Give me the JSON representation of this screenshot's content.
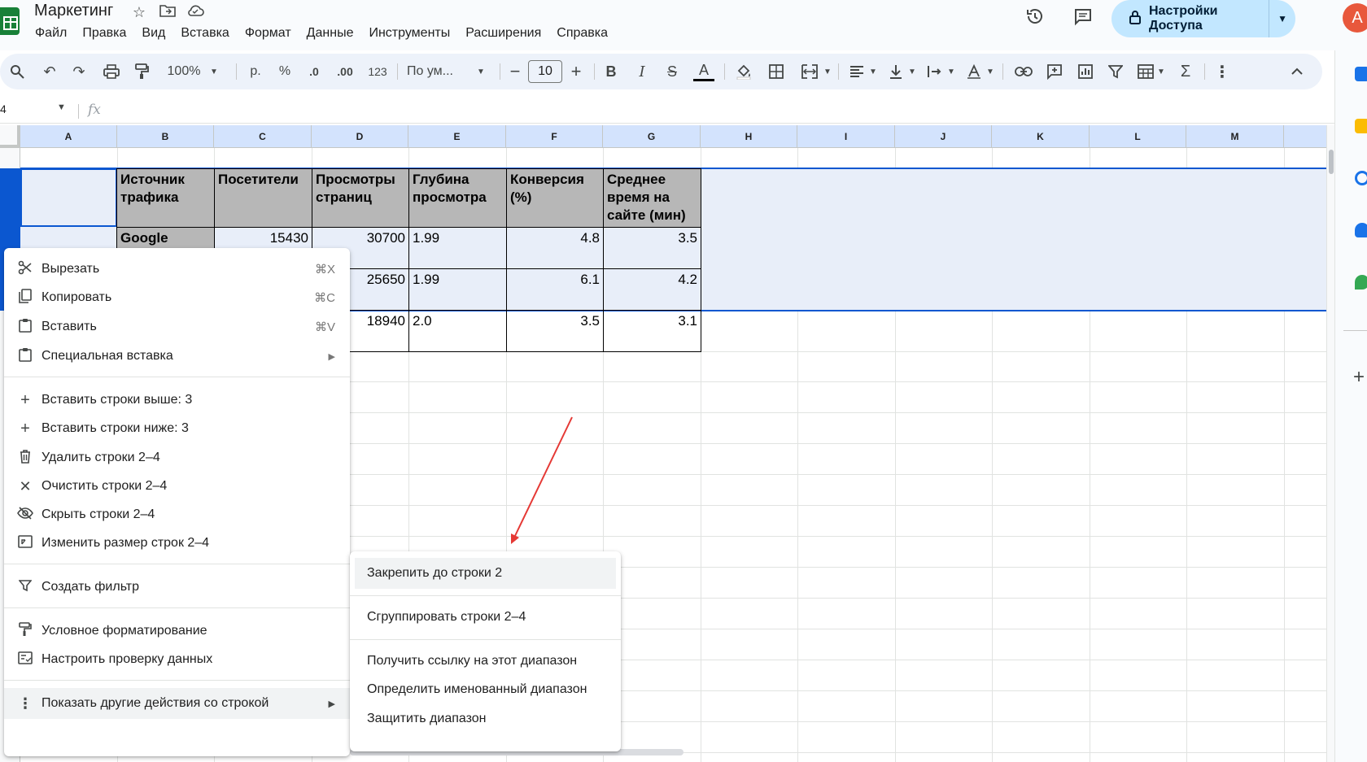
{
  "app": {
    "title": "Маркетинг",
    "menu": [
      "Файл",
      "Правка",
      "Вид",
      "Вставка",
      "Формат",
      "Данные",
      "Инструменты",
      "Расширения",
      "Справка"
    ],
    "share_label": "Настройки Доступа",
    "avatar_letter": "A"
  },
  "toolbar": {
    "zoom": "100%",
    "currency": "р.",
    "percent": "%",
    "dec_decrease": ".0",
    "dec_increase": ".00",
    "number_format": "123",
    "font": "По ум...",
    "font_size": "10"
  },
  "formula_bar": {
    "name_box": "4",
    "fx": "fx"
  },
  "grid": {
    "columns": [
      "A",
      "B",
      "C",
      "D",
      "E",
      "F",
      "G",
      "H",
      "I",
      "J",
      "K",
      "L",
      "M"
    ],
    "headers": [
      "Источник трафика",
      "Посетители",
      "Просмотры страниц",
      "Глубина просмотра",
      "Конверсия (%)",
      "Среднее время на сайте (мин)"
    ],
    "rows": [
      [
        "Google",
        "15430",
        "30700",
        "1.99",
        "4.8",
        "3.5"
      ],
      [
        "",
        "",
        "25650",
        "1.99",
        "6.1",
        "4.2"
      ],
      [
        "",
        "",
        "18940",
        "2.0",
        "3.5",
        "3.1"
      ]
    ]
  },
  "context_menu": {
    "items": [
      {
        "label": "Вырезать",
        "shortcut": "⌘X",
        "icon": "scissors-icon"
      },
      {
        "label": "Копировать",
        "shortcut": "⌘C",
        "icon": "copy-icon"
      },
      {
        "label": "Вставить",
        "shortcut": "⌘V",
        "icon": "paste-icon"
      },
      {
        "label": "Специальная вставка",
        "shortcut": "",
        "icon": "paste-special-icon"
      },
      {
        "label": "Вставить строки выше: 3",
        "shortcut": "",
        "icon": "plus-icon"
      },
      {
        "label": "Вставить строки ниже: 3",
        "shortcut": "",
        "icon": "plus-icon"
      },
      {
        "label": "Удалить строки 2–4",
        "shortcut": "",
        "icon": "trash-icon"
      },
      {
        "label": "Очистить строки 2–4",
        "shortcut": "",
        "icon": "clear-icon"
      },
      {
        "label": "Скрыть строки 2–4",
        "shortcut": "",
        "icon": "eye-off-icon"
      },
      {
        "label": "Изменить размер строк 2–4",
        "shortcut": "",
        "icon": "resize-icon"
      },
      {
        "label": "Создать фильтр",
        "shortcut": "",
        "icon": "filter-icon"
      },
      {
        "label": "Условное форматирование",
        "shortcut": "",
        "icon": "paint-roller-icon"
      },
      {
        "label": "Настроить проверку данных",
        "shortcut": "",
        "icon": "data-validation-icon"
      },
      {
        "label": "Показать другие действия со строкой",
        "shortcut": "",
        "icon": "more-vert-icon"
      }
    ]
  },
  "submenu": {
    "items": [
      "Закрепить до строки 2",
      "Сгруппировать строки 2–4",
      "Получить ссылку на этот диапазон",
      "Определить именованный диапазон",
      "Защитить диапазон"
    ]
  },
  "colors": {
    "accent": "#0b57d0",
    "share_bg": "#c2e7ff",
    "annotation_arrow": "#e53935"
  }
}
